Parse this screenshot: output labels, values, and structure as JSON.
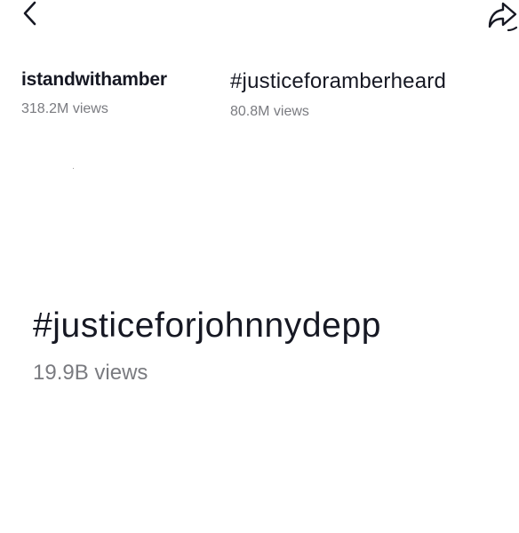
{
  "icons": {
    "back": "chevron-left-icon",
    "share": "share-arrow-icon"
  },
  "colors": {
    "title_text": "#161823",
    "views_text": "#7a7b80",
    "background": "#ffffff"
  },
  "hashtags": [
    {
      "title": "istandwithamber",
      "views": "318.2M views"
    },
    {
      "title": "#justiceforamberheard",
      "views": "80.8M views"
    },
    {
      "title": "#justiceforjohnnydepp",
      "views": "19.9B views"
    }
  ]
}
